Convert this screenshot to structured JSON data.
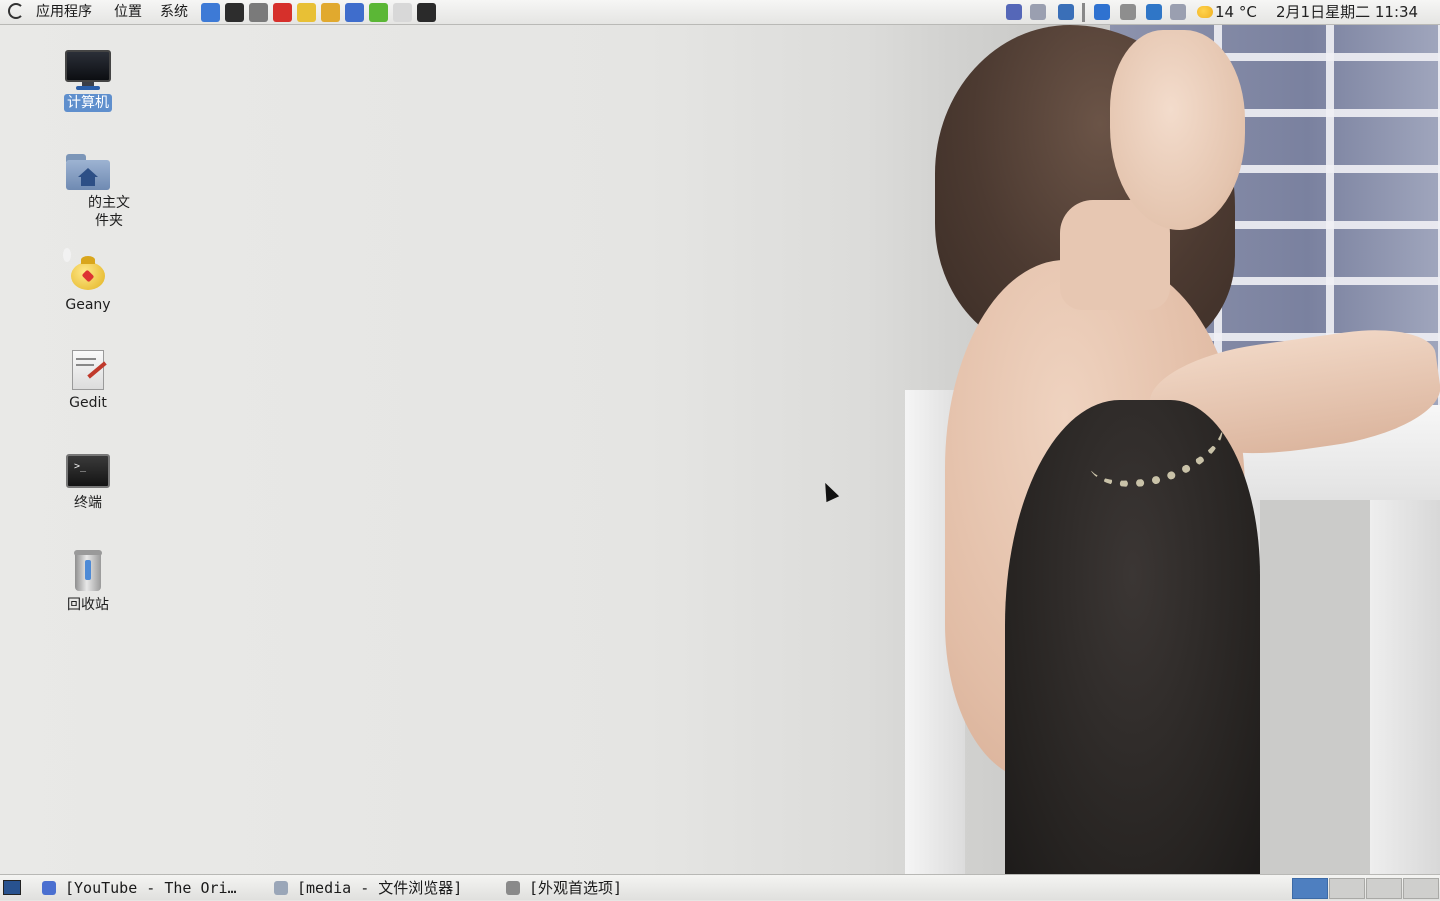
{
  "top_panel": {
    "menus": [
      "应用程序",
      "位置",
      "系统"
    ],
    "launchers": [
      {
        "icon": "pointer-tool-icon",
        "color": "#3d7ad6"
      },
      {
        "icon": "terminal-icon",
        "color": "#2d2d2d"
      },
      {
        "icon": "magic-wand-icon",
        "color": "#7a7a7a"
      },
      {
        "icon": "dictionary-icon",
        "color": "#d6302b"
      },
      {
        "icon": "geany-teapot-icon",
        "color": "#e8c035"
      },
      {
        "icon": "chrome-icon",
        "color": "#e1a92e"
      },
      {
        "icon": "firefox-icon",
        "color": "#3f6dcc"
      },
      {
        "icon": "download-icon",
        "color": "#5bb736"
      },
      {
        "icon": "text-editor-icon",
        "color": "#d8d8d8"
      },
      {
        "icon": "console-icon",
        "color": "#2a2a2a"
      }
    ],
    "tray": [
      {
        "icon": "bluetooth-icon",
        "color": "#5567b8"
      },
      {
        "icon": "volume-icon",
        "color": "#9a9fb0"
      },
      {
        "icon": "display-icon",
        "color": "#3a6fb8"
      },
      {
        "icon": "separator-icon",
        "color": "#888888"
      },
      {
        "icon": "pointer-icon",
        "color": "#2f72d0"
      },
      {
        "icon": "network-icon",
        "color": "#8e8e8e"
      },
      {
        "icon": "accessibility-icon",
        "color": "#2f76c7"
      },
      {
        "icon": "speaker-icon",
        "color": "#9a9fb0"
      }
    ],
    "weather": "14 °C",
    "clock": "2月1日星期二 11:34"
  },
  "desktop_icons": [
    {
      "label": "计算机",
      "icon": "computer-icon",
      "selected": true
    },
    {
      "label": "的主文件夹",
      "icon": "home-folder-icon",
      "selected": false
    },
    {
      "label": "Geany",
      "icon": "geany-icon",
      "selected": false
    },
    {
      "label": "Gedit",
      "icon": "gedit-icon",
      "selected": false
    },
    {
      "label": "终端",
      "icon": "terminal-icon",
      "selected": false
    },
    {
      "label": "回收站",
      "icon": "trash-icon",
      "selected": false
    }
  ],
  "taskbar": {
    "tasks": [
      {
        "label": "[YouTube - The Ori…",
        "icon": "firefox-icon",
        "color": "#4a6fd0"
      },
      {
        "label": "[media - 文件浏览器]",
        "icon": "folder-icon",
        "color": "#9aa6b8"
      },
      {
        "label": "[外观首选项]",
        "icon": "appearance-icon",
        "color": "#8a8a8a"
      }
    ],
    "workspaces": [
      {
        "active": true
      },
      {
        "active": false
      },
      {
        "active": false
      },
      {
        "active": false
      }
    ]
  }
}
